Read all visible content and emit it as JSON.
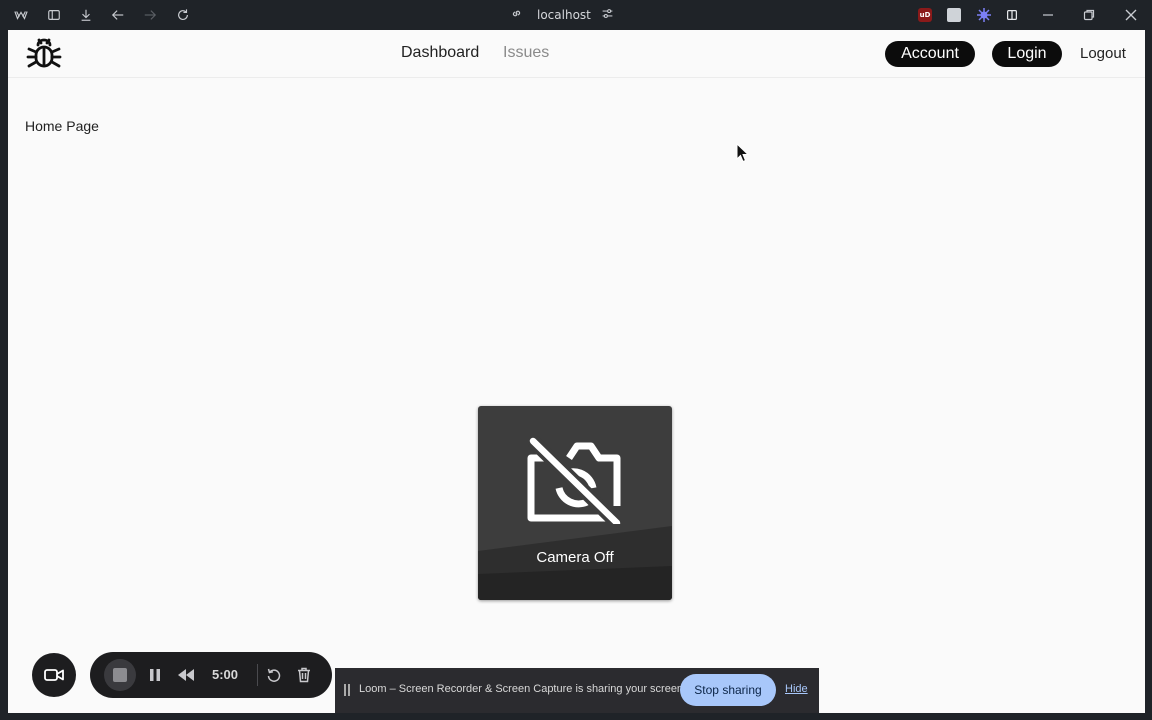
{
  "browser": {
    "url": "localhost",
    "toolbar_icons": [
      "workspaces-icon",
      "sidebar-icon",
      "download-icon",
      "back-icon",
      "forward-icon",
      "reload-icon"
    ],
    "extensions": {
      "ublock_label": "uD"
    }
  },
  "navbar": {
    "links": [
      {
        "label": "Dashboard",
        "active": true
      },
      {
        "label": "Issues",
        "active": false
      }
    ],
    "account_label": "Account",
    "login_label": "Login",
    "logout_label": "Logout"
  },
  "main": {
    "heading": "Home Page"
  },
  "camera": {
    "label": "Camera Off"
  },
  "loom": {
    "timer": "5:00"
  },
  "share_notice": {
    "message": "Loom – Screen Recorder & Screen Capture is sharing your screen.",
    "stop_label": "Stop sharing",
    "hide_label": "Hide"
  },
  "colors": {
    "page_background": "#fafafa",
    "pill_background": "#0c0c0c",
    "stop_sharing_button": "#a8c7fa",
    "chrome_background": "#1f2328"
  }
}
